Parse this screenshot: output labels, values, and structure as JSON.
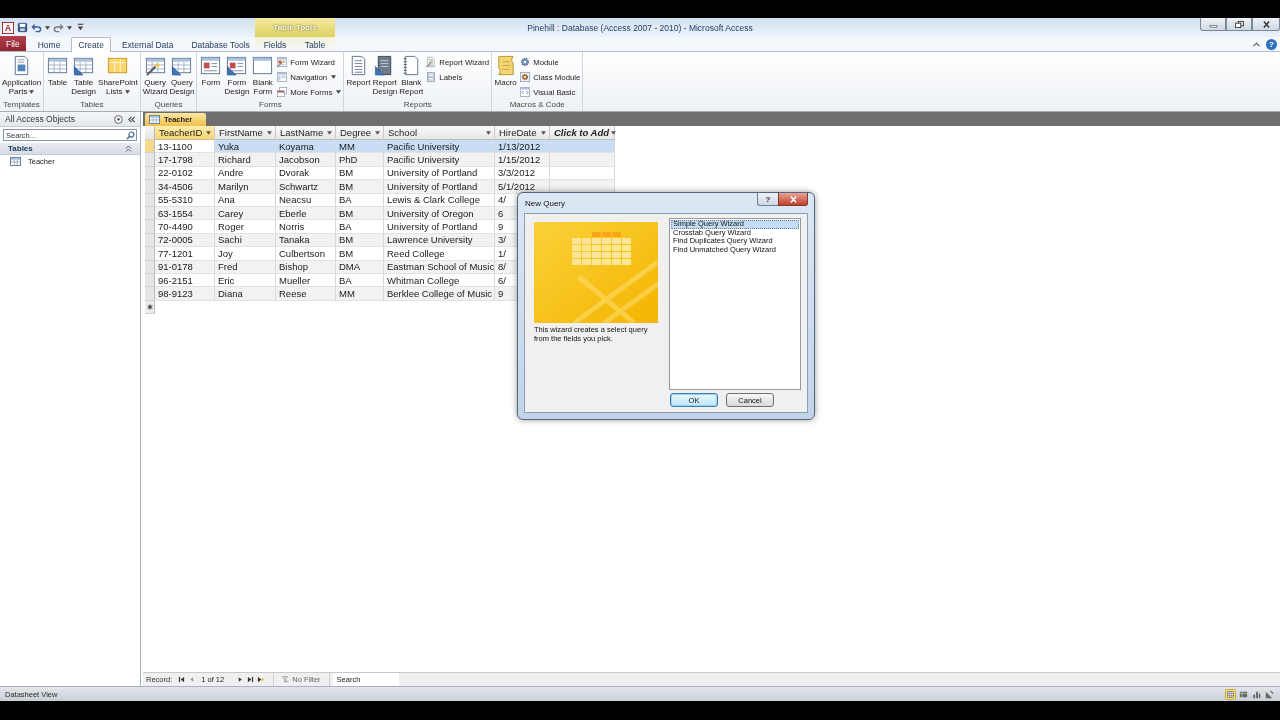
{
  "title_bar": {
    "logo": "A",
    "title": "Pinehill : Database (Access 2007 - 2010) - Microsoft Access"
  },
  "ribbon": {
    "contextual": {
      "label": "Table Tools"
    },
    "help": "?",
    "tabs": [
      {
        "label": "File",
        "kind": "file",
        "selected": false
      },
      {
        "label": "Home",
        "kind": "standard",
        "selected": false
      },
      {
        "label": "Create",
        "kind": "standard",
        "selected": true
      },
      {
        "label": "External Data",
        "kind": "standard",
        "selected": false
      },
      {
        "label": "Database Tools",
        "kind": "standard",
        "selected": false
      },
      {
        "label": "Fields",
        "kind": "contextual",
        "selected": false
      },
      {
        "label": "Table",
        "kind": "contextual",
        "selected": false
      }
    ],
    "groups": [
      {
        "label": "Templates",
        "large": [
          {
            "kind": "parts",
            "lines": [
              "Application",
              "Parts"
            ],
            "dropdown": true
          }
        ]
      },
      {
        "label": "Tables",
        "large": [
          {
            "kind": "table",
            "lines": [
              "Table"
            ]
          },
          {
            "kind": "tabledesign",
            "lines": [
              "Table",
              "Design"
            ]
          },
          {
            "kind": "sharepoint",
            "lines": [
              "SharePoint",
              "Lists"
            ],
            "dropdown": true
          }
        ]
      },
      {
        "label": "Queries",
        "large": [
          {
            "kind": "wizard",
            "lines": [
              "Query",
              "Wizard"
            ]
          },
          {
            "kind": "design",
            "lines": [
              "Query",
              "Design"
            ]
          }
        ]
      },
      {
        "label": "Forms",
        "large": [
          {
            "kind": "form",
            "lines": [
              "Form"
            ]
          },
          {
            "kind": "formdesign",
            "lines": [
              "Form",
              "Design"
            ]
          },
          {
            "kind": "blankform",
            "lines": [
              "Blank",
              "Form"
            ]
          }
        ],
        "small": [
          {
            "kind": "formwizard",
            "label": "Form Wizard"
          },
          {
            "kind": "navigation",
            "label": "Navigation",
            "dropdown": true
          },
          {
            "kind": "moreforms",
            "label": "More Forms",
            "dropdown": true
          }
        ]
      },
      {
        "label": "Reports",
        "large": [
          {
            "kind": "report",
            "lines": [
              "Report"
            ]
          },
          {
            "kind": "reportdesign",
            "lines": [
              "Report",
              "Design"
            ]
          },
          {
            "kind": "blankreport",
            "lines": [
              "Blank",
              "Report"
            ]
          }
        ],
        "small": [
          {
            "kind": "reportwizard",
            "label": "Report Wizard"
          },
          {
            "kind": "labels",
            "label": "Labels"
          }
        ]
      },
      {
        "label": "Macros & Code",
        "large": [
          {
            "kind": "macro",
            "lines": [
              "Macro"
            ]
          }
        ],
        "small": [
          {
            "kind": "module",
            "label": "Module"
          },
          {
            "kind": "classmodule",
            "label": "Class Module"
          },
          {
            "kind": "vba",
            "label": "Visual Basic"
          }
        ]
      }
    ]
  },
  "nav_pane": {
    "title": "All Access Objects",
    "search": {
      "placeholder": "Search..."
    },
    "groups": [
      {
        "label": "Tables",
        "expanded": true,
        "items": [
          {
            "label": "Teacher",
            "selected": false
          }
        ]
      }
    ]
  },
  "document": {
    "tabs": [
      {
        "label": "Teacher",
        "selected": true
      }
    ],
    "table": {
      "columns": [
        {
          "label": "TeacherID",
          "kind": "field",
          "selected": true
        },
        {
          "label": "FirstName",
          "kind": "field",
          "selected": false
        },
        {
          "label": "LastName",
          "kind": "field",
          "selected": false
        },
        {
          "label": "Degree",
          "kind": "field",
          "selected": false
        },
        {
          "label": "School",
          "kind": "field",
          "selected": false
        },
        {
          "label": "HireDate",
          "kind": "field",
          "selected": false
        },
        {
          "label": "Click to Add",
          "kind": "add",
          "selected": false
        }
      ],
      "rows": [
        {
          "selected": true,
          "cells": [
            "13-1100",
            "Yuka",
            "Koyama",
            "MM",
            "Pacific University",
            "1/13/2012"
          ]
        },
        {
          "selected": false,
          "cells": [
            "17-1798",
            "Richard",
            "Jacobson",
            "PhD",
            "Pacific University",
            "1/15/2012"
          ]
        },
        {
          "selected": false,
          "cells": [
            "22-0102",
            "Andre",
            "Dvorak",
            "BM",
            "University of Portland",
            "3/3/2012"
          ]
        },
        {
          "selected": false,
          "cells": [
            "34-4506",
            "Marilyn",
            "Schwartz",
            "BM",
            "University of Portland",
            "5/1/2012"
          ]
        },
        {
          "selected": false,
          "cells": [
            "55-5310",
            "Ana",
            "Neacsu",
            "BA",
            "Lewis & Clark College",
            "4/"
          ]
        },
        {
          "selected": false,
          "cells": [
            "63-1554",
            "Carey",
            "Eberle",
            "BM",
            "University of Oregon",
            "6"
          ]
        },
        {
          "selected": false,
          "cells": [
            "70-4490",
            "Roger",
            "Norris",
            "BA",
            "University of Portland",
            "9"
          ]
        },
        {
          "selected": false,
          "cells": [
            "72-0005",
            "Sachi",
            "Tanaka",
            "BM",
            "Lawrence University",
            "3/"
          ]
        },
        {
          "selected": false,
          "cells": [
            "77-1201",
            "Joy",
            "Culbertson",
            "BM",
            "Reed College",
            "1/"
          ]
        },
        {
          "selected": false,
          "cells": [
            "91-0178",
            "Fred",
            "Bishop",
            "DMA",
            "Eastman School of Music",
            "8/"
          ]
        },
        {
          "selected": false,
          "cells": [
            "96-2151",
            "Eric",
            "Mueller",
            "BA",
            "Whitman College",
            "6/"
          ]
        },
        {
          "selected": false,
          "cells": [
            "98-9123",
            "Diana",
            "Reese",
            "MM",
            "Berklee College of Music",
            "9"
          ]
        }
      ]
    },
    "record_bar": {
      "label": "Record:",
      "position": "1 of 12",
      "filter": "No Filter",
      "search": {
        "placeholder": "Search"
      }
    }
  },
  "status_bar": {
    "text": "Datasheet View",
    "views": [
      {
        "kind": "datasheet",
        "selected": true
      },
      {
        "kind": "pivottable",
        "selected": false
      },
      {
        "kind": "pivotchart",
        "selected": false
      },
      {
        "kind": "design",
        "selected": false
      }
    ]
  },
  "dialog": {
    "title": "New Query",
    "help": "?",
    "description": "This wizard creates a select query from the fields you pick.",
    "options": [
      {
        "label": "Simple Query Wizard",
        "selected": true
      },
      {
        "label": "Crosstab Query Wizard",
        "selected": false
      },
      {
        "label": "Find Duplicates Query Wizard",
        "selected": false
      },
      {
        "label": "Find Unmatched Query Wizard",
        "selected": false
      }
    ],
    "buttons": [
      {
        "label": "OK",
        "kind": "default"
      },
      {
        "label": "Cancel",
        "kind": "normal"
      }
    ]
  }
}
